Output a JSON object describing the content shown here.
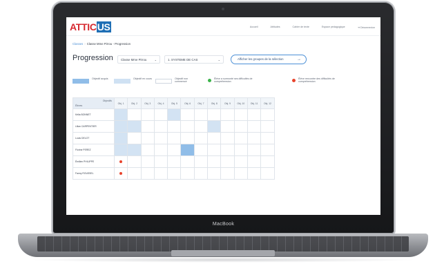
{
  "laptop": {
    "brand": "MacBook"
  },
  "app": {
    "logo": {
      "part1": "ATTIC",
      "part2": "US"
    },
    "nav": [
      "Accueil",
      "Attitudes",
      "Cahier de texte",
      "Espace pédagogique",
      "Déconnexion"
    ]
  },
  "breadcrumb": {
    "root": "Classes",
    "current": "Classe Mme Pirrou - Progression"
  },
  "page": {
    "title": "Progression",
    "class_select": "Classe Mme Pirrou",
    "sequence_select": "1. SYSTEME DE CAS",
    "groups_button": "Afficher les groupes de la sélection"
  },
  "legend": [
    {
      "kind": "acq",
      "label": "Objectif acquis"
    },
    {
      "kind": "enc",
      "label": "Objectif en cours"
    },
    {
      "kind": "non",
      "label": "Objectif non commencé"
    },
    {
      "kind": "green",
      "label": "Élève a surmonté ses difficultés de compréhension"
    },
    {
      "kind": "red",
      "label": "Élève rencontre des difficultés de compréhension"
    }
  ],
  "table": {
    "corner_top": "Objectifs",
    "corner_bottom": "Élèves",
    "objectives": [
      "Obj. 1",
      "Obj. 2",
      "Obj. 3",
      "Obj. 4",
      "Obj. 5",
      "Obj. 6",
      "Obj. 7",
      "Obj. 8",
      "Obj. 9",
      "Obj. 10",
      "Obj. 11",
      "Obj. 12"
    ],
    "students": [
      {
        "name": "Kélia BONNET",
        "cells": [
          "enc",
          "",
          "",
          "",
          "enc",
          "",
          "",
          "",
          "",
          "",
          "",
          ""
        ]
      },
      {
        "name": "Lilian CARPENTIER",
        "cells": [
          "enc",
          "enc",
          "",
          "",
          "",
          "",
          "",
          "enc",
          "",
          "",
          "",
          ""
        ]
      },
      {
        "name": "Louis DELOT",
        "cells": [
          "enc",
          "",
          "",
          "",
          "",
          "",
          "",
          "",
          "",
          "",
          "",
          ""
        ]
      },
      {
        "name": "Florine PEREZ",
        "cells": [
          "enc",
          "enc",
          "",
          "",
          "",
          "acq",
          "",
          "",
          "",
          "",
          "",
          ""
        ]
      },
      {
        "name": "Émilien PHILIPPE",
        "cells": [
          "red",
          "",
          "",
          "",
          "",
          "",
          "",
          "",
          "",
          "",
          "",
          ""
        ]
      },
      {
        "name": "Fanny ROUSSEL",
        "cells": [
          "red",
          "",
          "",
          "",
          "",
          "",
          "",
          "",
          "",
          "",
          "",
          ""
        ]
      }
    ]
  },
  "colors": {
    "accent_blue": "#1f6fb5",
    "logo_red": "#d6282f",
    "acquired": "#90bde8",
    "in_progress": "#d3e3f3",
    "difficulty_red": "#e8432c",
    "resolved_green": "#3bb34a"
  }
}
